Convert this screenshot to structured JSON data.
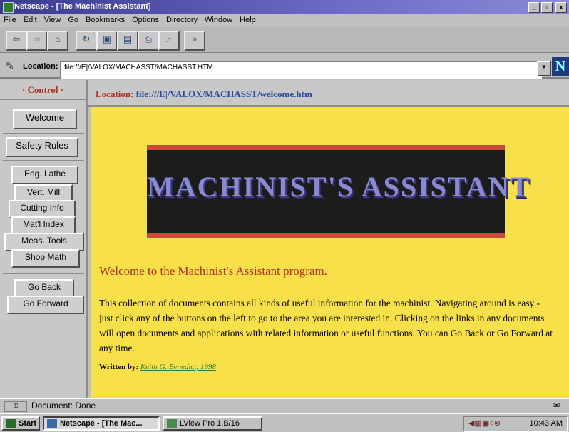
{
  "window": {
    "title": "Netscape - [The Machinist Assistant]",
    "controls": [
      "_",
      "▫",
      "x"
    ]
  },
  "menu": [
    "File",
    "Edit",
    "View",
    "Go",
    "Bookmarks",
    "Options",
    "Directory",
    "Window",
    "Help"
  ],
  "toolbar": {
    "buttons": [
      {
        "name": "back",
        "glyph": "⇦"
      },
      {
        "name": "forward",
        "glyph": "⇨"
      },
      {
        "name": "home",
        "glyph": "⌂"
      },
      {
        "name": "reload",
        "glyph": "↻"
      },
      {
        "name": "images",
        "glyph": "▣"
      },
      {
        "name": "open",
        "glyph": "▤"
      },
      {
        "name": "print",
        "glyph": "⎙"
      },
      {
        "name": "find",
        "glyph": "⌕"
      },
      {
        "name": "stop",
        "glyph": "●"
      }
    ]
  },
  "location": {
    "label": "Location:",
    "url": "file:///E|/VALOX/MACHASST/MACHASST.HTM",
    "logo": "N"
  },
  "control_frame": {
    "title": "· Control ·",
    "buttons": {
      "welcome": "Welcome",
      "safety": "Safety Rules",
      "lathe": "Eng. Lathe",
      "mill": "Vert. Mill",
      "cutting": "Cutting Info",
      "matl": "Mat'l Index",
      "meas": "Meas. Tools",
      "math": "Shop Math",
      "back": "Go Back",
      "forward": "Go Forward"
    }
  },
  "top_frame": {
    "label": "Location:",
    "url": "file:///E|/VALOX/MACHASST/welcome.htm"
  },
  "content": {
    "banner": "MACHINIST'S ASSISTANT",
    "heading": "Welcome to the Machinist's Assistant program.",
    "paragraph": "This collection of documents contains all kinds of useful information for the machinist. Navigating around is easy - just click any of the buttons on the left to go to the area you are interested in. Clicking on the links in any documents will open documents and applications with related information or useful functions. You can Go Back or Go Forward at any time.",
    "credit_label": "Written by:",
    "credit_author": "Keith G. Benedict, 1998"
  },
  "status": {
    "text": "Document: Done"
  },
  "taskbar": {
    "start": "Start",
    "tasks": [
      "Netscape - [The Mac...",
      "LView Pro 1.B/16"
    ],
    "clock": "10:43 AM"
  },
  "colors": {
    "content_bg": "#f7e04a",
    "heading": "#b03020",
    "banner_border": "#c84a3a",
    "link": "#2e7d32"
  }
}
